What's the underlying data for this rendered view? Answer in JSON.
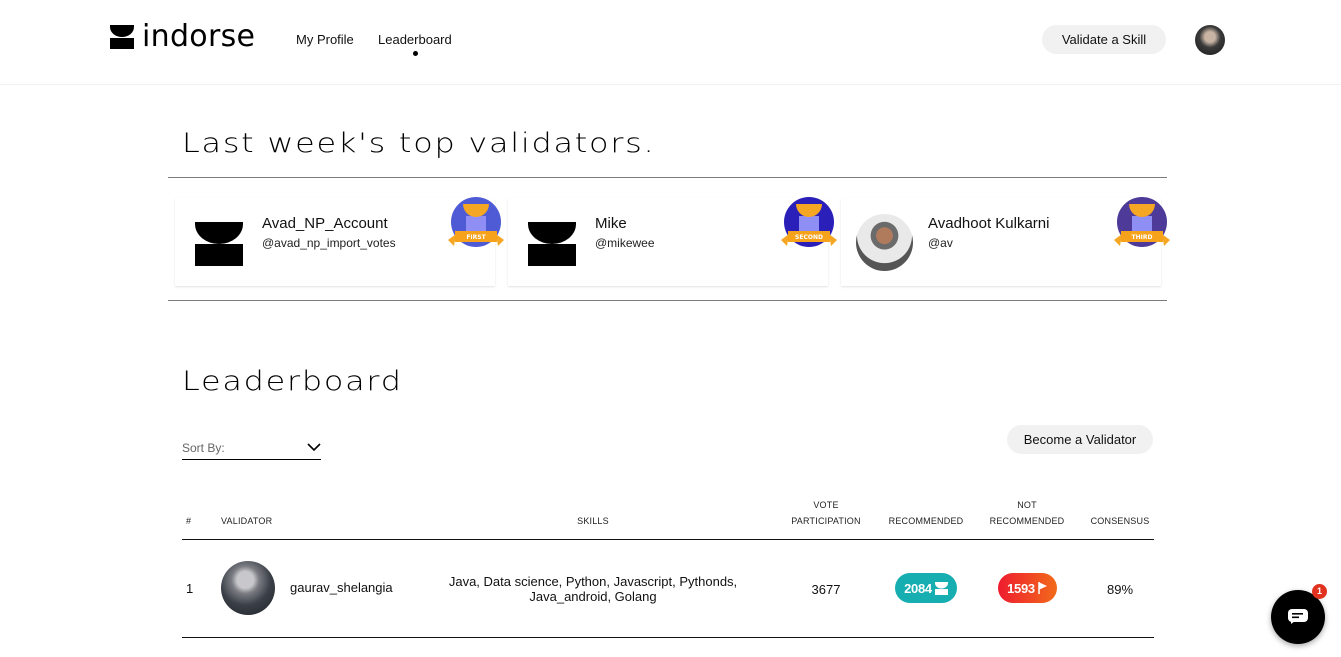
{
  "header": {
    "logo_text": "indorse",
    "nav": [
      {
        "label": "My Profile",
        "active": false
      },
      {
        "label": "Leaderboard",
        "active": true
      }
    ],
    "validate_button": "Validate a Skill"
  },
  "top_validators": {
    "title": "Last week's top validators.",
    "cards": [
      {
        "name": "Avad_NP_Account",
        "handle": "@avad_np_import_votes",
        "badge": "FIRST",
        "badge_color": "#4f5bd5",
        "avatar": "indorse-logo-icon"
      },
      {
        "name": "Mike",
        "handle": "@mikewee",
        "badge": "SECOND",
        "badge_color": "#2a1fb8",
        "avatar": "indorse-logo-icon"
      },
      {
        "name": "Avadhoot Kulkarni",
        "handle": "@av",
        "badge": "THIRD",
        "badge_color": "#4e3a99",
        "avatar": "user-photo"
      }
    ]
  },
  "leaderboard": {
    "title": "Leaderboard",
    "sort_label": "Sort By:",
    "become_validator_button": "Become a Validator",
    "columns": {
      "num": "#",
      "validator": "VALIDATOR",
      "skills": "SKILLS",
      "vote_line1": "VOTE",
      "vote_line2": "PARTICIPATION",
      "recommended": "RECOMMENDED",
      "not_rec_line1": "NOT",
      "not_rec_line2": "RECOMMENDED",
      "consensus": "CONSENSUS"
    },
    "rows": [
      {
        "rank": "1",
        "username": "gaurav_shelangia",
        "skills": "Java, Data science, Python, Javascript, Pythonds, Java_android, Golang",
        "vote_participation": "3677",
        "recommended": "2084",
        "not_recommended": "1593",
        "consensus": "89%"
      }
    ]
  },
  "colors": {
    "recommended": "#16aeb0",
    "not_recommended_start": "#ee1c2f",
    "not_recommended_end": "#f26a1b",
    "button_bg": "#f1f1f1"
  },
  "chat": {
    "unread_count": "1"
  }
}
